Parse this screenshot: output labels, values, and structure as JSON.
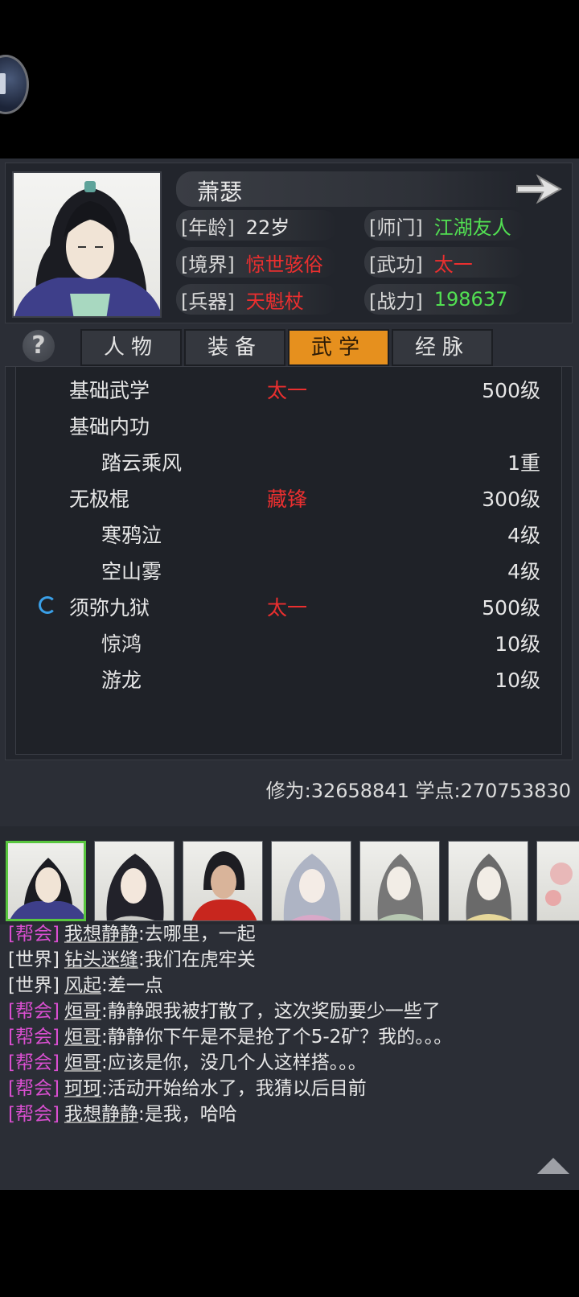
{
  "character": {
    "name": "萧瑟",
    "attributes": [
      {
        "label": "[年龄]",
        "value": "22岁",
        "color": "white"
      },
      {
        "label": "[师门]",
        "value": "江湖友人",
        "color": "green"
      },
      {
        "label": "[境界]",
        "value": "惊世骇俗",
        "color": "red"
      },
      {
        "label": "[武功]",
        "value": "太一",
        "color": "red"
      },
      {
        "label": "[兵器]",
        "value": "天魁杖",
        "color": "red"
      },
      {
        "label": "[战力]",
        "value": "198637",
        "color": "green"
      }
    ]
  },
  "tabs": [
    {
      "label": "人物",
      "active": false
    },
    {
      "label": "装备",
      "active": false
    },
    {
      "label": "武学",
      "active": true
    },
    {
      "label": "经脉",
      "active": false
    }
  ],
  "help_icon": "?",
  "skills": [
    {
      "name": "基础武学",
      "style": "太一",
      "level": "500级",
      "indent": false,
      "spinner": false
    },
    {
      "name": "基础内功",
      "style": "",
      "level": "",
      "indent": false,
      "spinner": false
    },
    {
      "name": "踏云乘风",
      "style": "",
      "level": "1重",
      "indent": true,
      "spinner": false
    },
    {
      "name": "无极棍",
      "style": "藏锋",
      "level": "300级",
      "indent": false,
      "spinner": false
    },
    {
      "name": "寒鸦泣",
      "style": "",
      "level": "4级",
      "indent": true,
      "spinner": false
    },
    {
      "name": "空山雾",
      "style": "",
      "level": "4级",
      "indent": true,
      "spinner": false
    },
    {
      "name": "须弥九狱",
      "style": "太一",
      "level": "500级",
      "indent": false,
      "spinner": true
    },
    {
      "name": "惊鸿",
      "style": "",
      "level": "10级",
      "indent": true,
      "spinner": false
    },
    {
      "name": "游龙",
      "style": "",
      "level": "10级",
      "indent": true,
      "spinner": false
    }
  ],
  "points_text": "修为:32658841 学点:270753830",
  "roster_count": 7,
  "chat": [
    {
      "channel": "[帮会]",
      "type": "guild",
      "sender": "我想静静",
      "text": ":去哪里，一起"
    },
    {
      "channel": "[世界]",
      "type": "world",
      "sender": "钻头迷缝",
      "text": ":我们在虎牢关"
    },
    {
      "channel": "[世界]",
      "type": "world",
      "sender": "风起",
      "text": ":差一点"
    },
    {
      "channel": "[帮会]",
      "type": "guild",
      "sender": "烜哥",
      "text": ":静静跟我被打散了，这次奖励要少一些了"
    },
    {
      "channel": "[帮会]",
      "type": "guild",
      "sender": "烜哥",
      "text": ":静静你下午是不是抢了个5-2矿？我的。。。"
    },
    {
      "channel": "[帮会]",
      "type": "guild",
      "sender": "烜哥",
      "text": ":应该是你，没几个人这样搭。。。"
    },
    {
      "channel": "[帮会]",
      "type": "guild",
      "sender": "珂珂",
      "text": ":活动开始给水了，我猜以后目前"
    },
    {
      "channel": "[帮会]",
      "type": "guild",
      "sender": "我想静静",
      "text": ":是我，哈哈"
    }
  ]
}
